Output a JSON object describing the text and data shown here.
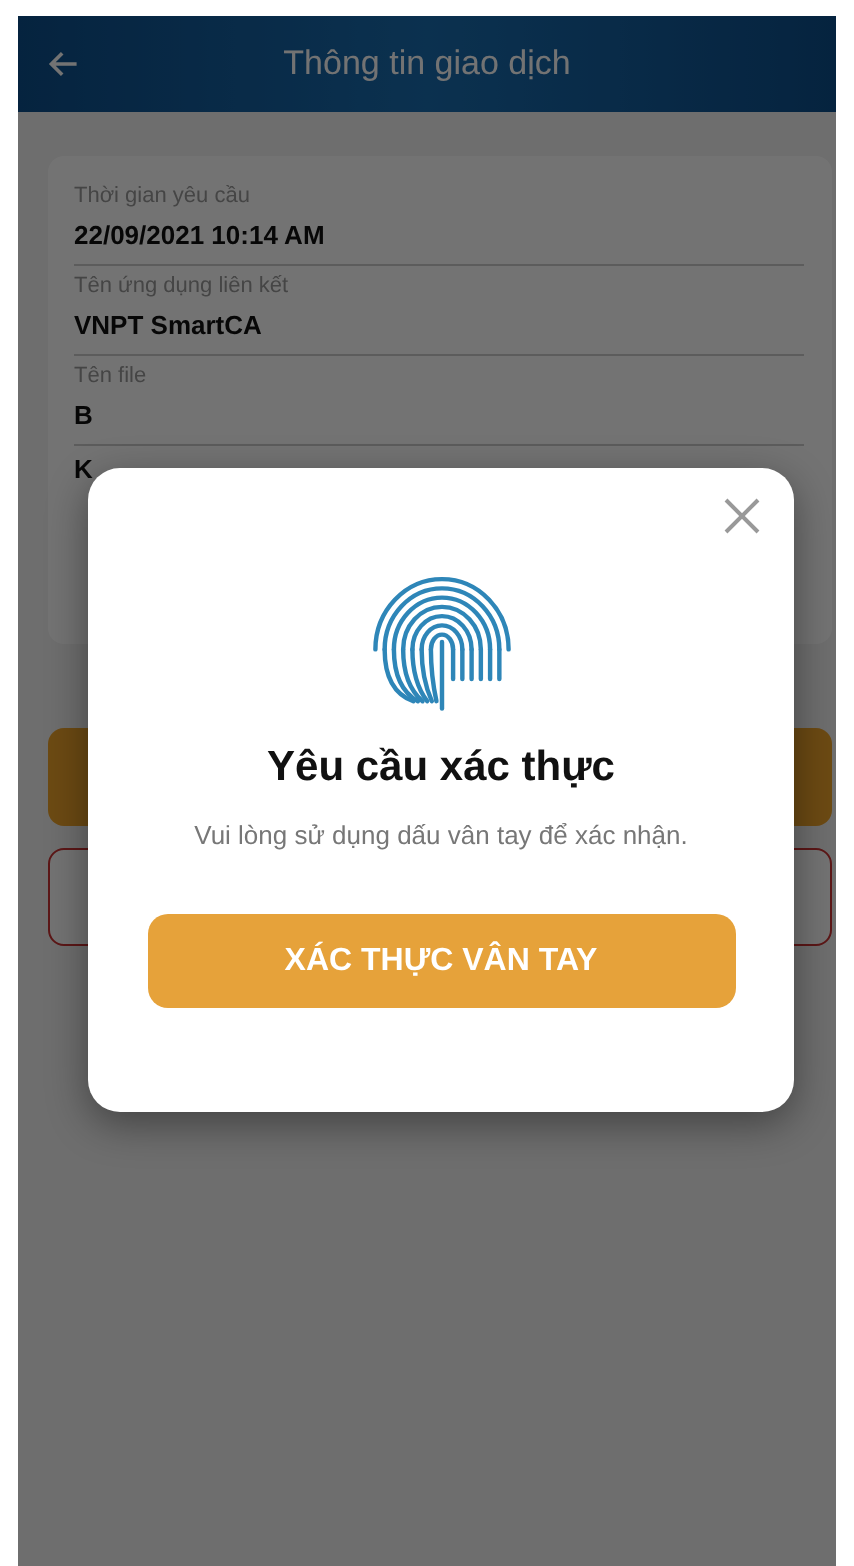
{
  "header": {
    "title": "Thông tin giao dịch"
  },
  "fields": [
    {
      "label": "Thời gian yêu cầu",
      "value": "22/09/2021 10:14 AM"
    },
    {
      "label": "Tên ứng dụng liên kết",
      "value": "VNPT SmartCA"
    },
    {
      "label": "Tên file",
      "value": "B"
    },
    {
      "value": "K"
    }
  ],
  "dialog": {
    "title": "Yêu cầu xác thực",
    "message": "Vui lòng sử dụng dấu vân tay để xác nhận.",
    "button": "XÁC THỰC VÂN TAY"
  }
}
